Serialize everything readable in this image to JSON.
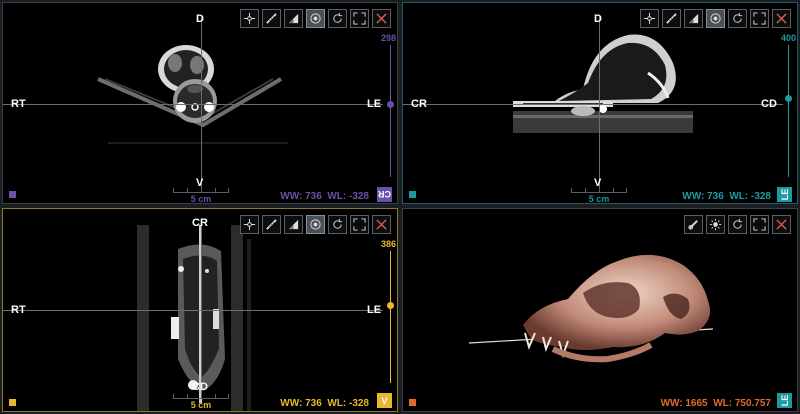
{
  "colors": {
    "axial": "#6b4fa8",
    "sagittal": "#1d9aa0",
    "coronal": "#e8b830",
    "volume": "#e06a2a"
  },
  "viewports": {
    "axial": {
      "orient_top": "D",
      "orient_bottom": "V",
      "orient_left": "RT",
      "orient_right": "LE",
      "slice": "298",
      "scale": "5 cm",
      "ww": "WW: 736",
      "wl": "WL: -328",
      "badge": "CR",
      "tools": [
        "crosshair-icon",
        "ruler-icon",
        "window-level-icon",
        "scroll-icon",
        "reset-icon",
        "maximize-icon",
        "close-icon"
      ]
    },
    "sagittal": {
      "orient_top": "D",
      "orient_bottom": "V",
      "orient_left": "CR",
      "orient_right": "CD",
      "slice": "400",
      "scale": "5 cm",
      "ww": "WW: 736",
      "wl": "WL: -328",
      "badge": "LE",
      "tools": [
        "crosshair-icon",
        "ruler-icon",
        "window-level-icon",
        "scroll-icon",
        "reset-icon",
        "maximize-icon",
        "close-icon"
      ]
    },
    "coronal": {
      "orient_top": "CR",
      "orient_bottom": "CD",
      "orient_left": "RT",
      "orient_right": "LE",
      "slice": "386",
      "scale": "5 cm",
      "ww": "WW: 736",
      "wl": "WL: -328",
      "badge": "V",
      "tools": [
        "crosshair-icon",
        "ruler-icon",
        "window-level-icon",
        "scroll-icon",
        "reset-icon",
        "maximize-icon",
        "close-icon"
      ]
    },
    "volume": {
      "ww": "WW: 1665",
      "wl": "WL: 750.757",
      "badge": "LE",
      "tools": [
        "preset-icon",
        "brightness-icon",
        "reset-icon",
        "maximize-icon",
        "close-icon"
      ]
    }
  }
}
